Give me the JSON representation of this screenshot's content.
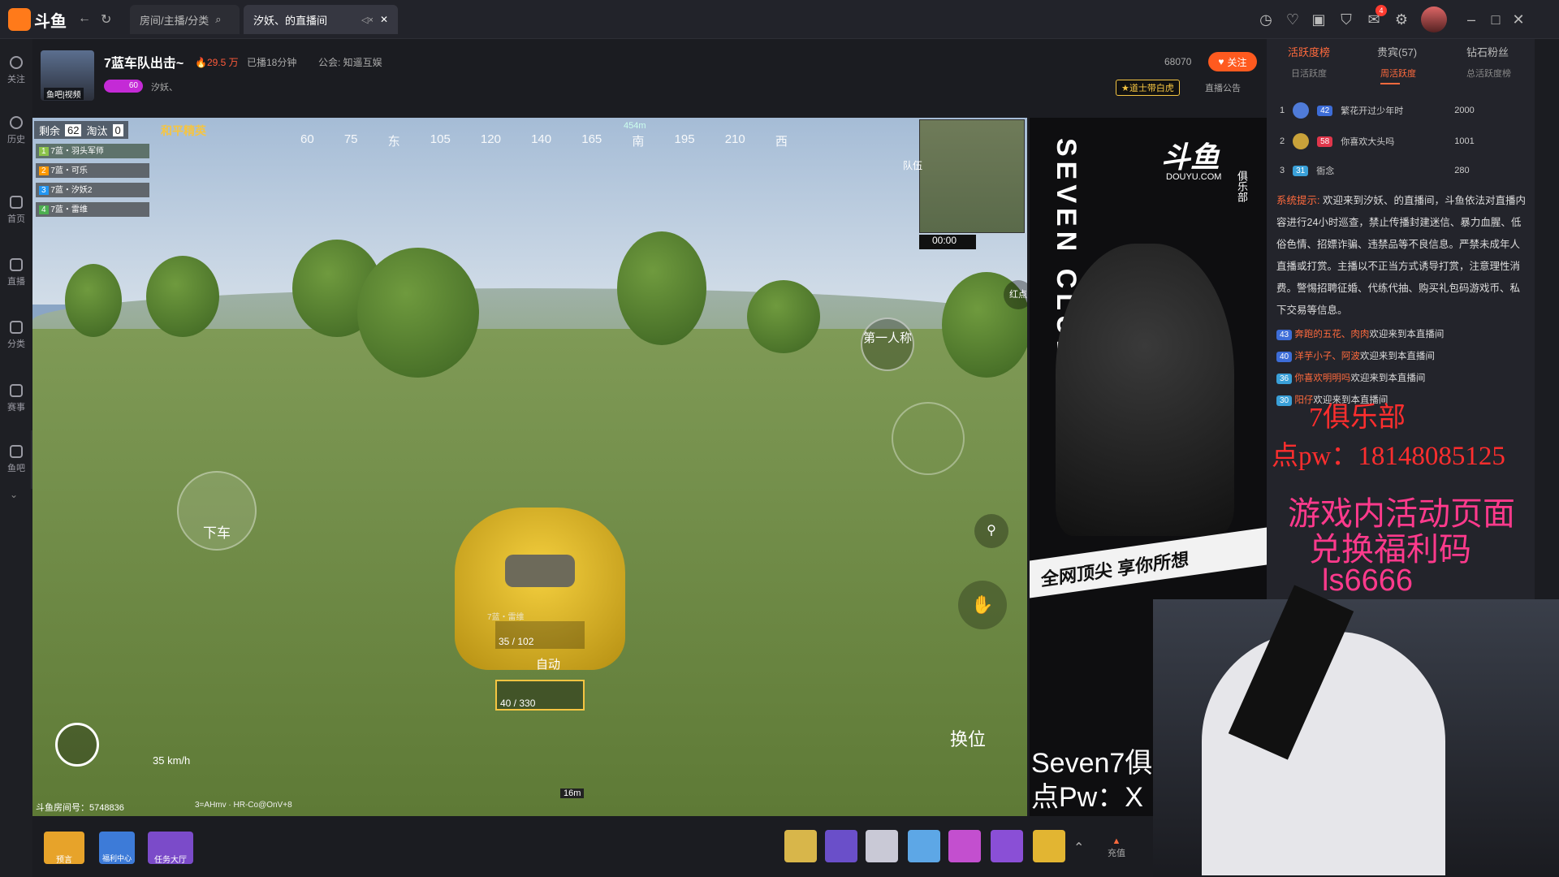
{
  "window": {
    "logo": "斗鱼",
    "logo_sub": "DOUYU.COM",
    "tabs": [
      {
        "label": "房间/主播/分类",
        "icon": "search-icon"
      },
      {
        "label": "汐妖、的直播间",
        "icon": "mute-icon"
      }
    ],
    "badge_count": "4"
  },
  "sidebar": {
    "items": [
      {
        "label": "关注",
        "icon": "heart-icon"
      },
      {
        "label": "历史",
        "icon": "clock-icon"
      },
      {
        "label": "首页",
        "icon": "home-icon"
      },
      {
        "label": "直播",
        "icon": "live-icon"
      },
      {
        "label": "分类",
        "icon": "grid-icon"
      },
      {
        "label": "赛事",
        "icon": "trophy-icon"
      },
      {
        "label": "鱼吧",
        "icon": "fish-icon"
      }
    ]
  },
  "stream": {
    "title": "7蓝车队出击~",
    "hot": "29.5 万",
    "duration": "已播18分钟",
    "guild": "公会: 知遥互娱",
    "streamer": "汐妖、",
    "fan_level": "60",
    "follow_count": "68070",
    "follow_label": "关注",
    "badge": "★道士带白虎",
    "notice": "直播公告",
    "avatar_caption": "鱼吧|视频"
  },
  "game": {
    "remaining_label": "剩余",
    "remaining": "62",
    "eliminated_label": "淘汰",
    "eliminated": "0",
    "tier": "和平精英",
    "compass": [
      "60",
      "75",
      "东",
      "105",
      "120",
      "140",
      "165",
      "南",
      "195",
      "210",
      "西"
    ],
    "marker_distance": "454m",
    "team": [
      "7蓝・羽头军师",
      "7蓝・可乐",
      "7蓝・汐妖2",
      "7蓝・雷维"
    ],
    "team_voice": "队伍",
    "timer": "00:00",
    "red_point": "红点",
    "first_person": "第一人称",
    "exit_vehicle": "下车",
    "switch_seat": "换位",
    "fire_mode": "自动",
    "ammo_1": "35 / 102",
    "ammo_2": "40 / 330",
    "speed": "35 km/h",
    "distance": "16m",
    "player_tag": "7蓝・雷维",
    "room_id": "斗鱼房间号：5748836",
    "version_info": "3=AHmv · HR-Co@OnV+8"
  },
  "promo": {
    "club": "SEVEN CLUB",
    "logo": "斗鱼",
    "logo_sub": "DOUYU.COM",
    "club_short": "俱乐部",
    "slogan": "全网顶尖 享你所想",
    "overlay_1": "Seven7俱",
    "overlay_2": "点Pw：X"
  },
  "right_panel": {
    "tabs": [
      "活跃度榜",
      "贵宾(57)",
      "钻石粉丝"
    ],
    "subtabs": [
      "日活跃度",
      "周活跃度",
      "总活跃度榜"
    ],
    "ranks": [
      {
        "pos": "1",
        "level": "42",
        "name": "繁花开过少年时",
        "score": "2000"
      },
      {
        "pos": "2",
        "level": "58",
        "name": "你喜欢大头吗",
        "score": "1001"
      },
      {
        "pos": "3",
        "level": "31",
        "name": "衙念",
        "score": "280"
      }
    ],
    "system_label": "系统提示:",
    "system_text": "欢迎来到汐妖、的直播间，斗鱼依法对直播内容进行24小时巡查，禁止传播封建迷信、暴力血腥、低俗色情、招嫖诈骗、违禁品等不良信息。严禁未成年人直播或打赏。主播以不正当方式诱导打赏，注意理性消费。警惕招聘征婚、代练代抽、购买礼包码游戏币、私下交易等信息。",
    "chat": [
      {
        "level": "43",
        "name": "奔跑的五花、肉肉",
        "text": "欢迎来到本直播间"
      },
      {
        "level": "40",
        "name": "洋芋小子、阿波",
        "text": "欢迎来到本直播间"
      },
      {
        "level": "36",
        "name": "你喜欢明明吗",
        "text": "欢迎来到本直播间"
      },
      {
        "level": "30",
        "name": "阳仔",
        "text": "欢迎来到本直播间"
      }
    ]
  },
  "overlay": {
    "club_text": "7俱乐部",
    "pw_text": "点pw：18148085125",
    "event_line1": "游戏内活动页面",
    "event_line2": "兑换福利码",
    "code": "ls6666"
  },
  "bottom": {
    "items": [
      "预言",
      "福利中心",
      "任务大厅"
    ],
    "recharge": "充值"
  },
  "colors": {
    "accent": "#ff5a1f",
    "overlay_red": "#ff2e2e",
    "bg": "#1b1c21"
  }
}
